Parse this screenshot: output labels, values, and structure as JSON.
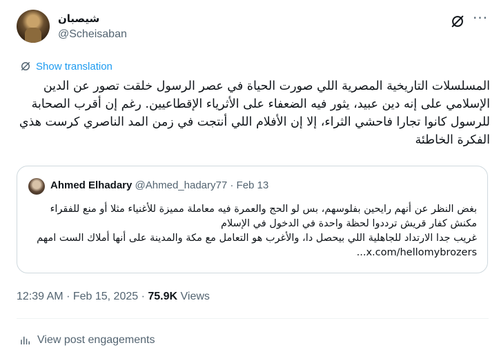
{
  "author": {
    "display_name": "شيصبان",
    "handle": "@Scheisaban"
  },
  "actions": {
    "grok_icon": "grok-icon",
    "more_icon": "more-icon",
    "more_label": "···"
  },
  "translate": {
    "icon": "translate-icon",
    "label": "Show translation"
  },
  "tweet": {
    "text": "المسلسلات التاريخية المصرية اللي صورت الحياة في عصر الرسول خلقت تصور عن الدين الإسلامي على إنه دين عبيد، يثور فيه الضعفاء على الأثرياء الإقطاعيين. رغم إن أقرب الصحابة للرسول كانوا تجارا فاحشي الثراء، إلا إن الأفلام اللي أنتجت في زمن المد الناصري كرست هذي الفكرة الخاطئة"
  },
  "quote": {
    "name": "Ahmed Elhadary",
    "handle": "@Ahmed_hadary77",
    "separator": "·",
    "date": "Feb 13",
    "line1": "بغض النظر عن أنهم رايحين بفلوسهم، بس لو الحج والعمرة فيه معاملة مميزة للأغنياء مثلا أو منع للفقراء مكنش كفار قريش ترددوا لحظة واحدة في الدخول في الإسلام",
    "line2": "غريب جدا الارتداد للجاهلية اللي بيحصل دا، والأغرب هو التعامل مع مكة والمدينة على أنها أملاك الست امهم",
    "link": "x.com/hellomybrozers..."
  },
  "meta": {
    "time": "12:39 AM",
    "separator": "·",
    "date": "Feb 15, 2025",
    "views_count": "75.9K",
    "views_label": "Views"
  },
  "engagements": {
    "icon": "bar-chart-icon",
    "label": "View post engagements"
  },
  "colors": {
    "accent": "#1d9bf0",
    "text": "#0f1419",
    "muted": "#536471",
    "border": "#cfd9de"
  }
}
